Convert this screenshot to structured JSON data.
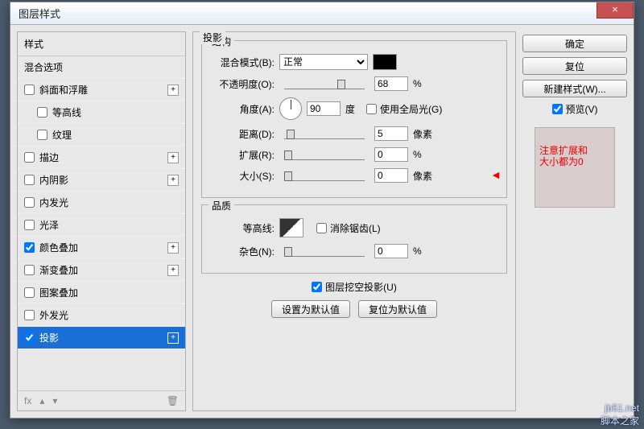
{
  "window": {
    "title": "图层样式"
  },
  "styles": {
    "header": "样式",
    "blend": "混合选项",
    "items": [
      {
        "label": "斜面和浮雕",
        "checked": false,
        "plus": true,
        "sub": false
      },
      {
        "label": "等高线",
        "checked": false,
        "plus": false,
        "sub": true
      },
      {
        "label": "纹理",
        "checked": false,
        "plus": false,
        "sub": true
      },
      {
        "label": "描边",
        "checked": false,
        "plus": true,
        "sub": false
      },
      {
        "label": "内阴影",
        "checked": false,
        "plus": true,
        "sub": false
      },
      {
        "label": "内发光",
        "checked": false,
        "plus": false,
        "sub": false
      },
      {
        "label": "光泽",
        "checked": false,
        "plus": false,
        "sub": false
      },
      {
        "label": "颜色叠加",
        "checked": true,
        "plus": true,
        "sub": false
      },
      {
        "label": "渐变叠加",
        "checked": false,
        "plus": true,
        "sub": false
      },
      {
        "label": "图案叠加",
        "checked": false,
        "plus": false,
        "sub": false
      },
      {
        "label": "外发光",
        "checked": false,
        "plus": false,
        "sub": false
      },
      {
        "label": "投影",
        "checked": true,
        "plus": true,
        "sub": false,
        "selected": true
      }
    ],
    "footer_fx": "fx"
  },
  "shadow": {
    "panel": "投影",
    "structure": "结构",
    "blend_mode_label": "混合模式(B):",
    "blend_mode_value": "正常",
    "opacity_label": "不透明度(O):",
    "opacity_value": "68",
    "opacity_unit": "%",
    "angle_label": "角度(A):",
    "angle_value": "90",
    "angle_unit": "度",
    "global_light": "使用全局光(G)",
    "global_light_checked": false,
    "distance_label": "距离(D):",
    "distance_value": "5",
    "distance_unit": "像素",
    "spread_label": "扩展(R):",
    "spread_value": "0",
    "spread_unit": "%",
    "size_label": "大小(S):",
    "size_value": "0",
    "size_unit": "像素",
    "quality": "品质",
    "contour_label": "等高线:",
    "antialias": "消除锯齿(L)",
    "antialias_checked": false,
    "noise_label": "杂色(N):",
    "noise_value": "0",
    "noise_unit": "%",
    "knockout": "图层挖空投影(U)",
    "knockout_checked": true,
    "make_default": "设置为默认值",
    "reset_default": "复位为默认值"
  },
  "annotation": {
    "line1": "注意扩展和",
    "line2": "大小都为0"
  },
  "buttons": {
    "ok": "确定",
    "cancel": "复位",
    "new_style": "新建样式(W)...",
    "preview": "预览(V)",
    "preview_checked": true
  },
  "watermark": {
    "url": "jb51.net",
    "name": "脚本之家"
  }
}
